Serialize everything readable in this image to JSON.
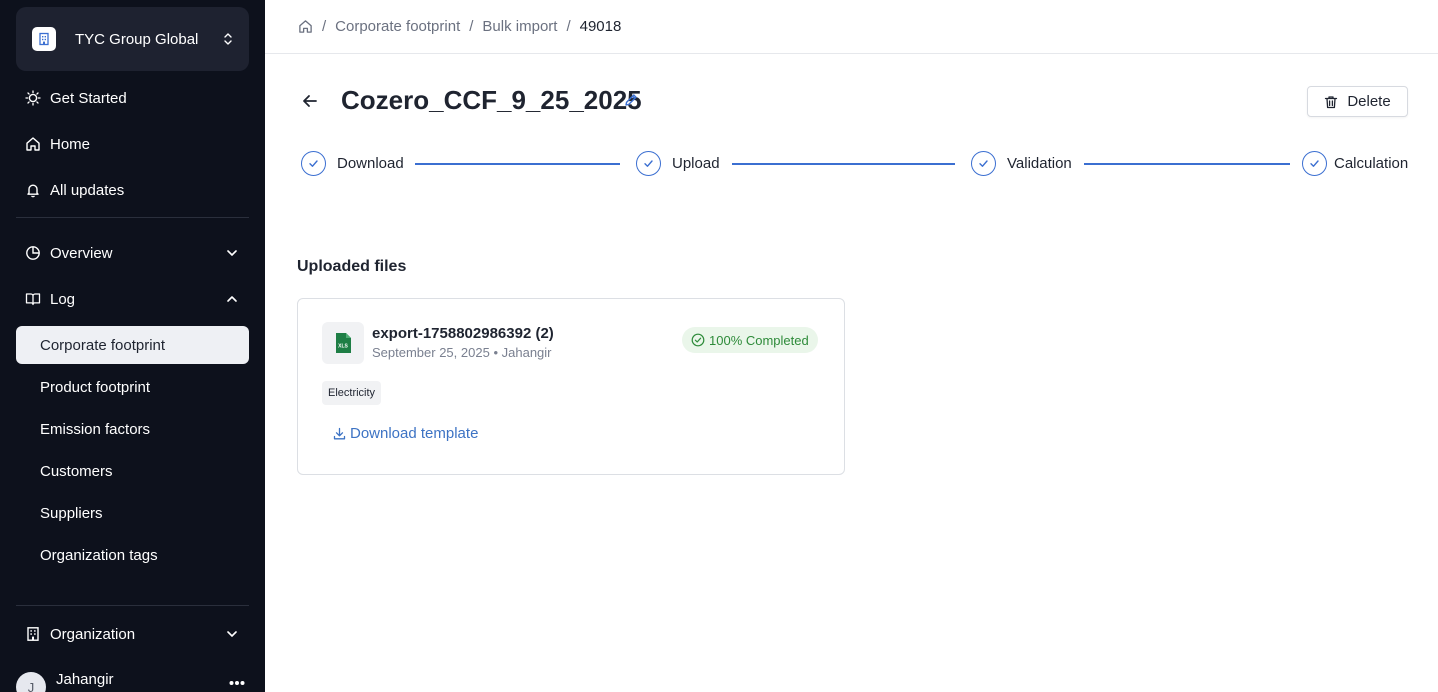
{
  "sidebar": {
    "org_name": "TYC Group Global",
    "nav": {
      "get_started": "Get Started",
      "home": "Home",
      "all_updates": "All updates",
      "overview": "Overview",
      "log": "Log",
      "organization": "Organization"
    },
    "log_items": [
      {
        "label": "Corporate footprint",
        "active": true
      },
      {
        "label": "Product footprint"
      },
      {
        "label": "Emission factors"
      },
      {
        "label": "Customers"
      },
      {
        "label": "Suppliers"
      },
      {
        "label": "Organization tags"
      }
    ],
    "user": {
      "initial": "J",
      "name": "Jahangir"
    }
  },
  "breadcrumb": {
    "items": [
      "Corporate footprint",
      "Bulk import"
    ],
    "current": "49018",
    "separator": "/"
  },
  "page": {
    "title": "Cozero_CCF_9_25_2025",
    "delete_label": "Delete"
  },
  "steps": [
    {
      "label": "Download",
      "done": true
    },
    {
      "label": "Upload",
      "done": true
    },
    {
      "label": "Validation",
      "done": true
    },
    {
      "label": "Calculation",
      "done": true
    }
  ],
  "uploaded_files": {
    "section_title": "Uploaded files",
    "file": {
      "name": "export-1758802986392 (2)",
      "date": "September 25, 2025",
      "author": "Jahangir",
      "meta_separator": "•",
      "file_type_badge": "XLS",
      "status": "100% Completed",
      "tag": "Electricity",
      "download_label": "Download template"
    }
  },
  "colors": {
    "sidebar_bg": "#0d111c",
    "accent_blue": "#3b6fd1",
    "link_blue": "#3d73c4",
    "success_green": "#2e8b3a",
    "excel_green": "#1e7e45"
  }
}
